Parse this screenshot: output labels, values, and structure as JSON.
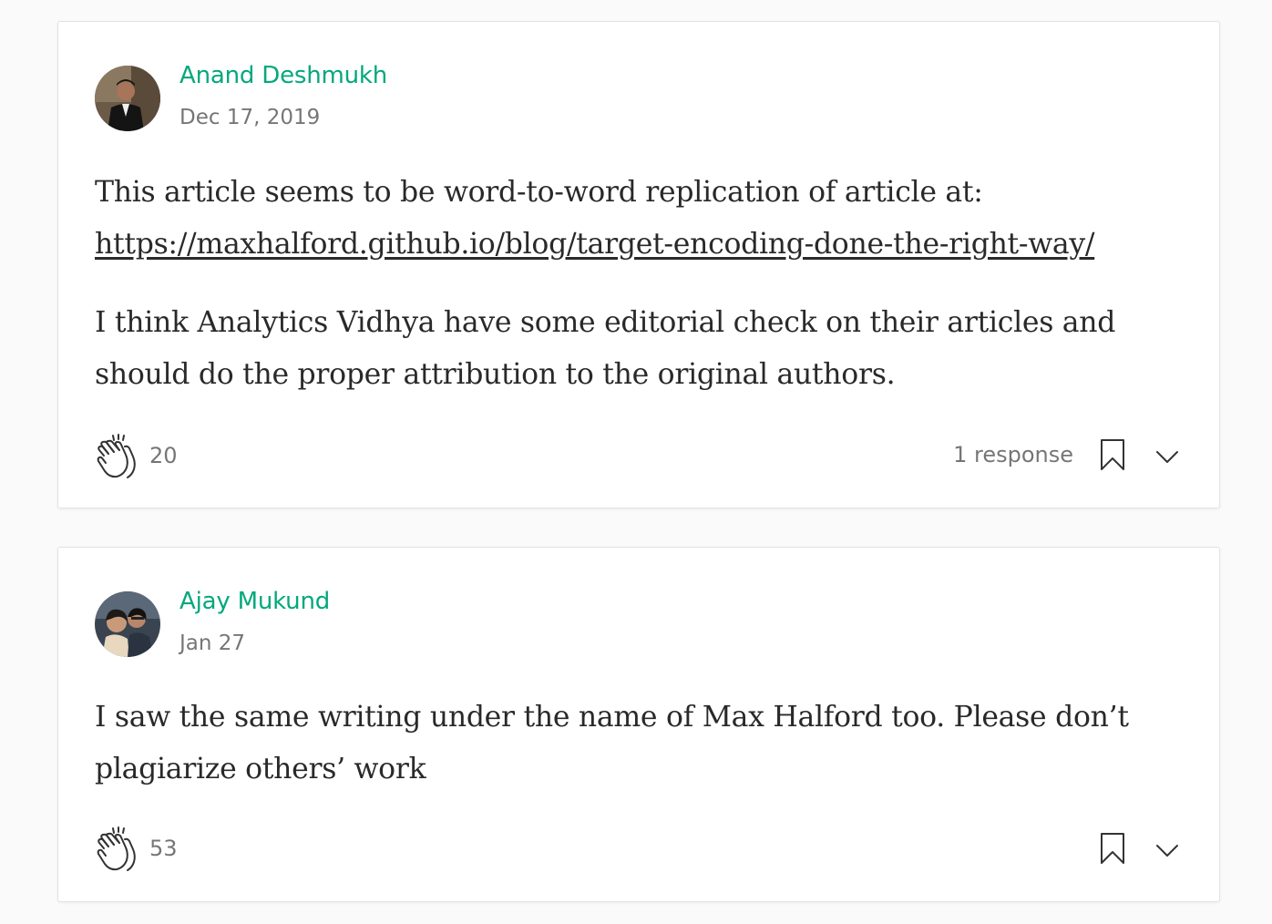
{
  "responses": [
    {
      "author": "Anand Deshmukh",
      "date": "Dec 17, 2019",
      "paragraph1": "This article seems to be word-to-word replication of article at:",
      "link": "https://maxhalford.github.io/blog/target-encoding-done-the-right-way/",
      "paragraph2": "I think Analytics Vidhya have some editorial check on their articles and should do the proper attribution to the original authors.",
      "claps": "20",
      "response_count": "1 response",
      "icons": [
        "clap-icon",
        "bookmark-icon",
        "chevron-down-icon"
      ]
    },
    {
      "author": "Ajay Mukund",
      "date": "Jan 27",
      "paragraph1": "I saw the same writing under the name of Max Halford too. Please don’t plagiarize others’ work",
      "claps": "53",
      "icons": [
        "clap-icon",
        "bookmark-icon",
        "chevron-down-icon"
      ]
    }
  ],
  "colors": {
    "accent": "#03a87c",
    "text": "#292929",
    "meta": "#757575",
    "background": "#fafafa"
  }
}
